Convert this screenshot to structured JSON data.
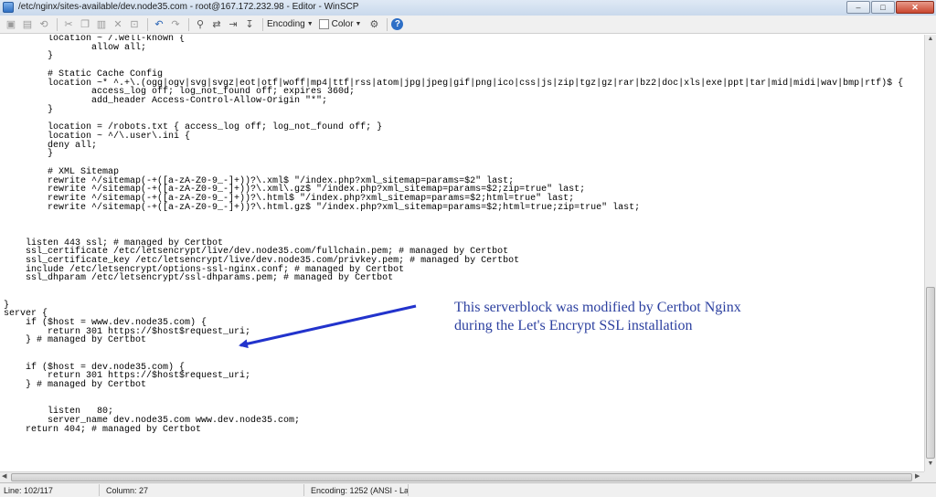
{
  "window": {
    "title": "/etc/nginx/sites-available/dev.node35.com - root@167.172.232.98 - Editor - WinSCP",
    "minimize": "–",
    "maximize": "□",
    "close": "✕"
  },
  "toolbar": {
    "encoding_label": "Encoding",
    "color_label": "Color",
    "help_label": "?"
  },
  "editor": {
    "lines": [
      "        location ~ /.well-known {",
      "                allow all;",
      "        }",
      "",
      "        # Static Cache Config",
      "        location ~* ^.+\\.(ogg|ogv|svg|svgz|eot|otf|woff|mp4|ttf|rss|atom|jpg|jpeg|gif|png|ico|css|js|zip|tgz|gz|rar|bz2|doc|xls|exe|ppt|tar|mid|midi|wav|bmp|rtf)$ {",
      "                access_log off; log_not_found off; expires 360d;",
      "                add_header Access-Control-Allow-Origin \"*\";",
      "        }",
      "",
      "        location = /robots.txt { access_log off; log_not_found off; }",
      "        location ~ ^/\\.user\\.ini {",
      "        deny all;",
      "        }",
      "",
      "        # XML Sitemap",
      "        rewrite ^/sitemap(-+([a-zA-Z0-9_-]+))?\\.xml$ \"/index.php?xml_sitemap=params=$2\" last;",
      "        rewrite ^/sitemap(-+([a-zA-Z0-9_-]+))?\\.xml\\.gz$ \"/index.php?xml_sitemap=params=$2;zip=true\" last;",
      "        rewrite ^/sitemap(-+([a-zA-Z0-9_-]+))?\\.html$ \"/index.php?xml_sitemap=params=$2;html=true\" last;",
      "        rewrite ^/sitemap(-+([a-zA-Z0-9_-]+))?\\.html.gz$ \"/index.php?xml_sitemap=params=$2;html=true;zip=true\" last;",
      "",
      "",
      "",
      "    listen 443 ssl; # managed by Certbot",
      "    ssl_certificate /etc/letsencrypt/live/dev.node35.com/fullchain.pem; # managed by Certbot",
      "    ssl_certificate_key /etc/letsencrypt/live/dev.node35.com/privkey.pem; # managed by Certbot",
      "    include /etc/letsencrypt/options-ssl-nginx.conf; # managed by Certbot",
      "    ssl_dhparam /etc/letsencrypt/ssl-dhparams.pem; # managed by Certbot",
      "",
      "",
      "}",
      "server {",
      "    if ($host = www.dev.node35.com) {",
      "        return 301 https://$host$request_uri;",
      "    } # managed by Certbot",
      "",
      "",
      "    if ($host = dev.node35.com) {",
      "        return 301 https://$host$request_uri;",
      "    } # managed by Certbot",
      "",
      "",
      "        listen   80;",
      "        server_name dev.node35.com www.dev.node35.com;",
      "    return 404; # managed by Certbot",
      "",
      "",
      "",
      "",
      "",
      "}"
    ]
  },
  "annotation": {
    "line1": "This serverblock was modified by Certbot Nginx",
    "line2": "during the Let's Encrypt SSL installation",
    "color": "#2b3f9f"
  },
  "status": {
    "line": "Line: 102/117",
    "column": "Column: 27",
    "encoding": "Encoding: 1252  (ANSI - La"
  }
}
